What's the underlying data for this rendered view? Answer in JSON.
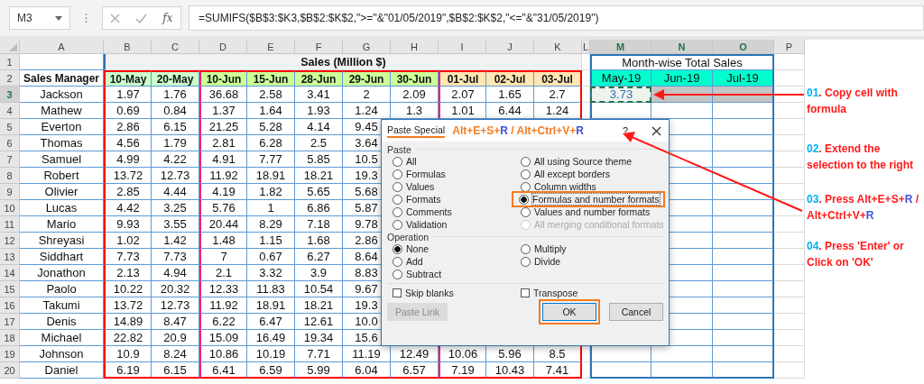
{
  "formula_bar": {
    "name_box": "M3",
    "function_label": "fx",
    "formula": "=SUMIFS($B$3:$K3,$B$2:$K$2,\">=\"&\"01/05/2019\",$B$2:$K$2,\"<=\"&\"31/05/2019\")"
  },
  "sheet": {
    "columns": [
      {
        "label": "A",
        "selected": false
      },
      {
        "label": "B",
        "selected": false
      },
      {
        "label": "C",
        "selected": false
      },
      {
        "label": "D",
        "selected": false
      },
      {
        "label": "E",
        "selected": false
      },
      {
        "label": "F",
        "selected": false
      },
      {
        "label": "G",
        "selected": false
      },
      {
        "label": "H",
        "selected": false
      },
      {
        "label": "I",
        "selected": false
      },
      {
        "label": "J",
        "selected": false
      },
      {
        "label": "K",
        "selected": false
      },
      {
        "label": "L",
        "selected": false
      },
      {
        "label": "M",
        "selected": true
      },
      {
        "label": "N",
        "selected": true
      },
      {
        "label": "O",
        "selected": true
      },
      {
        "label": "P",
        "selected": false
      }
    ],
    "rows": [
      {
        "number": "1",
        "selected": false
      },
      {
        "number": "2",
        "selected": false
      },
      {
        "number": "3",
        "selected": true
      },
      {
        "number": "4",
        "selected": false
      },
      {
        "number": "5",
        "selected": false
      },
      {
        "number": "6",
        "selected": false
      },
      {
        "number": "7",
        "selected": false
      },
      {
        "number": "8",
        "selected": false
      },
      {
        "number": "9",
        "selected": false
      },
      {
        "number": "10",
        "selected": false
      },
      {
        "number": "11",
        "selected": false
      },
      {
        "number": "12",
        "selected": false
      },
      {
        "number": "13",
        "selected": false
      },
      {
        "number": "14",
        "selected": false
      },
      {
        "number": "15",
        "selected": false
      },
      {
        "number": "16",
        "selected": false
      },
      {
        "number": "17",
        "selected": false
      },
      {
        "number": "18",
        "selected": false
      },
      {
        "number": "19",
        "selected": false
      },
      {
        "number": "20",
        "selected": false
      }
    ]
  },
  "sales_table": {
    "title": "Sales (Million $)",
    "manager_header": "Sales Manager",
    "dates": [
      {
        "label": "10-May",
        "color": "#ccffcc"
      },
      {
        "label": "20-May",
        "color": "#ccffcc"
      },
      {
        "label": "10-Jun",
        "color": "#ccff99"
      },
      {
        "label": "15-Jun",
        "color": "#ccff99"
      },
      {
        "label": "28-Jun",
        "color": "#ccff99"
      },
      {
        "label": "29-Jun",
        "color": "#ccff99"
      },
      {
        "label": "30-Jun",
        "color": "#ccff99"
      },
      {
        "label": "01-Jul",
        "color": "#ffe6b3"
      },
      {
        "label": "02-Jul",
        "color": "#ffe6b3"
      },
      {
        "label": "03-Jul",
        "color": "#ffe6b3"
      }
    ],
    "rows": [
      {
        "manager": "Jackson",
        "values": [
          "1.97",
          "1.76",
          "36.68",
          "2.58",
          "3.41",
          "2",
          "2.09",
          "2.07",
          "1.65",
          "2.7"
        ]
      },
      {
        "manager": "Mathew",
        "values": [
          "0.69",
          "0.84",
          "1.37",
          "1.64",
          "1.93",
          "1.24",
          "1.3",
          "1.01",
          "6.44",
          "1.24"
        ]
      },
      {
        "manager": "Everton",
        "values": [
          "2.86",
          "6.15",
          "21.25",
          "5.28",
          "4.14",
          "9.45"
        ]
      },
      {
        "manager": "Thomas",
        "values": [
          "4.56",
          "1.79",
          "2.81",
          "6.28",
          "2.5",
          "3.64"
        ]
      },
      {
        "manager": "Samuel",
        "values": [
          "4.99",
          "4.22",
          "4.91",
          "7.77",
          "5.85",
          "10.5"
        ]
      },
      {
        "manager": "Robert",
        "values": [
          "13.72",
          "12.73",
          "11.92",
          "18.91",
          "18.21",
          "19.3"
        ]
      },
      {
        "manager": "Olivier",
        "values": [
          "2.85",
          "4.44",
          "4.19",
          "1.82",
          "5.65",
          "5.68"
        ]
      },
      {
        "manager": "Lucas",
        "values": [
          "4.42",
          "3.25",
          "5.76",
          "1",
          "6.86",
          "5.87"
        ]
      },
      {
        "manager": "Mario",
        "values": [
          "9.93",
          "3.55",
          "20.44",
          "8.29",
          "7.18",
          "9.78"
        ]
      },
      {
        "manager": "Shreyasi",
        "values": [
          "1.02",
          "1.42",
          "1.48",
          "1.15",
          "1.68",
          "2.86"
        ]
      },
      {
        "manager": "Siddhart",
        "values": [
          "7.73",
          "7.73",
          "7",
          "0.67",
          "6.27",
          "8.64"
        ]
      },
      {
        "manager": "Jonathon",
        "values": [
          "2.13",
          "4.94",
          "2.1",
          "3.32",
          "3.9",
          "8.83"
        ]
      },
      {
        "manager": "Paolo",
        "values": [
          "10.22",
          "20.32",
          "12.33",
          "11.83",
          "10.54",
          "9.67"
        ]
      },
      {
        "manager": "Takumi",
        "values": [
          "13.72",
          "12.73",
          "11.92",
          "18.91",
          "18.21",
          "19.3"
        ]
      },
      {
        "manager": "Denis",
        "values": [
          "14.89",
          "8.47",
          "6.22",
          "6.47",
          "12.61",
          "10.0"
        ]
      },
      {
        "manager": "Michael",
        "values": [
          "22.82",
          "20.9",
          "15.09",
          "16.49",
          "19.34",
          "15.6"
        ]
      },
      {
        "manager": "Johnson",
        "values": [
          "10.9",
          "8.24",
          "10.86",
          "10.19",
          "7.71",
          "11.19",
          "12.49",
          "10.06",
          "5.96",
          "8.5"
        ]
      },
      {
        "manager": "Daniel",
        "values": [
          "6.19",
          "6.15",
          "6.41",
          "6.59",
          "5.99",
          "6.04",
          "6.57",
          "7.19",
          "10.43",
          "7.41"
        ]
      }
    ]
  },
  "monthly_table": {
    "title": "Month-wise Total Sales",
    "months": [
      "May-19",
      "Jun-19",
      "Jul-19"
    ],
    "first_row": [
      {
        "value": "3.73",
        "copied": true,
        "selected": false
      },
      {
        "copied": false,
        "selected": true
      },
      {
        "copied": false,
        "selected": true
      }
    ]
  },
  "dialog": {
    "title": "Paste Special",
    "shortcut": [
      {
        "text": "Alt+E+S+",
        "color": "#f47b20"
      },
      {
        "text": "R",
        "color": "#3f51d8"
      },
      {
        "text": " / Alt+Ctrl+V+",
        "color": "#f47b20"
      },
      {
        "text": "R",
        "color": "#3f51d8"
      }
    ],
    "help": "?",
    "paste_label": "Paste",
    "paste_columns": [
      {
        "options": [
          {
            "label": "All",
            "selected": false,
            "disabled": false,
            "highlighted": false
          },
          {
            "label": "Formulas",
            "selected": false,
            "disabled": false,
            "highlighted": false
          },
          {
            "label": "Values",
            "selected": false,
            "disabled": false,
            "highlighted": false
          },
          {
            "label": "Formats",
            "selected": false,
            "disabled": false,
            "highlighted": false
          },
          {
            "label": "Comments",
            "selected": false,
            "disabled": false,
            "highlighted": false
          },
          {
            "label": "Validation",
            "selected": false,
            "disabled": false,
            "highlighted": false
          }
        ]
      },
      {
        "options": [
          {
            "label": "All using Source theme",
            "selected": false,
            "disabled": false,
            "highlighted": false
          },
          {
            "label": "All except borders",
            "selected": false,
            "disabled": false,
            "highlighted": false
          },
          {
            "label": "Column widths",
            "selected": false,
            "disabled": false,
            "highlighted": false
          },
          {
            "label": "Formulas and number formats",
            "selected": true,
            "disabled": false,
            "highlighted": true
          },
          {
            "label": "Values and number formats",
            "selected": false,
            "disabled": false,
            "highlighted": false
          },
          {
            "label": "All merging conditional formats",
            "selected": false,
            "disabled": true,
            "highlighted": false
          }
        ]
      }
    ],
    "operation_label": "Operation",
    "operation_columns": [
      {
        "options": [
          {
            "label": "None",
            "selected": true
          },
          {
            "label": "Add",
            "selected": false
          },
          {
            "label": "Subtract",
            "selected": false
          }
        ]
      },
      {
        "options": [
          {
            "label": "Multiply",
            "selected": false
          },
          {
            "label": "Divide",
            "selected": false
          }
        ]
      }
    ],
    "checkboxes": [
      {
        "label": "Skip blanks",
        "checked": false
      },
      {
        "label": "Transpose",
        "checked": false
      }
    ],
    "buttons": [
      {
        "label": "Paste Link",
        "disabled": true,
        "highlighted": false
      },
      {
        "label": "OK",
        "disabled": false,
        "highlighted": true
      },
      {
        "label": "Cancel",
        "disabled": false,
        "highlighted": false
      }
    ]
  },
  "annotations": [
    {
      "number": "01",
      "parts": [
        {
          "text": ". Copy cell with formula",
          "color": "#ff1a1a"
        }
      ]
    },
    {
      "number": "02",
      "parts": [
        {
          "text": ". Extend the selection to the right",
          "color": "#ff1a1a"
        }
      ]
    },
    {
      "number": "03",
      "parts": [
        {
          "text": ". Press Alt+E+S+",
          "color": "#ff1a1a"
        },
        {
          "text": "R",
          "color": "#3f51d8"
        },
        {
          "text": " / Alt+Ctrl+V+",
          "color": "#ff1a1a"
        },
        {
          "text": "R",
          "color": "#3f51d8"
        }
      ]
    },
    {
      "number": "04",
      "parts": [
        {
          "text": ". Press 'Enter' or Click on 'OK'",
          "color": "#ff1a1a"
        }
      ]
    }
  ]
}
